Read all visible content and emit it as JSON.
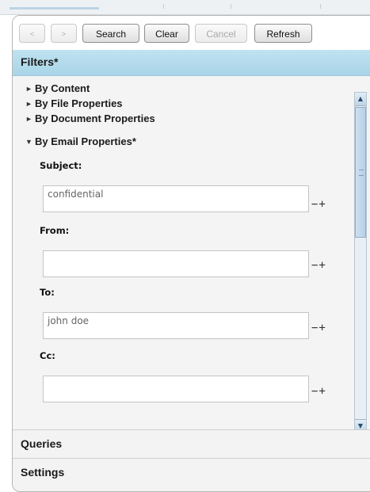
{
  "toolbar": {
    "back_label": "<",
    "forward_label": ">",
    "search_label": "Search",
    "clear_label": "Clear",
    "cancel_label": "Cancel",
    "refresh_label": "Refresh"
  },
  "filters": {
    "title": "Filters*",
    "tree": [
      {
        "arrow": "►",
        "label": "By Content"
      },
      {
        "arrow": "►",
        "label": "By File Properties"
      },
      {
        "arrow": "►",
        "label": "By Document Properties"
      },
      {
        "arrow": "▼",
        "label": "By Email Properties*"
      }
    ],
    "fields": [
      {
        "label": "Subject:",
        "value": "confidential",
        "controls": "−+"
      },
      {
        "label": "From:",
        "value": "",
        "controls": "−+"
      },
      {
        "label": "To:",
        "value": "john doe",
        "controls": "−+"
      },
      {
        "label": "Cc:",
        "value": "",
        "controls": "−+"
      }
    ]
  },
  "sections": {
    "queries": "Queries",
    "settings": "Settings"
  },
  "scrollbar": {
    "up_icon": "▲",
    "down_icon": "▼"
  },
  "colors": {
    "header_bg": "#afd8ea",
    "panel_bg": "#f3f3f3"
  }
}
